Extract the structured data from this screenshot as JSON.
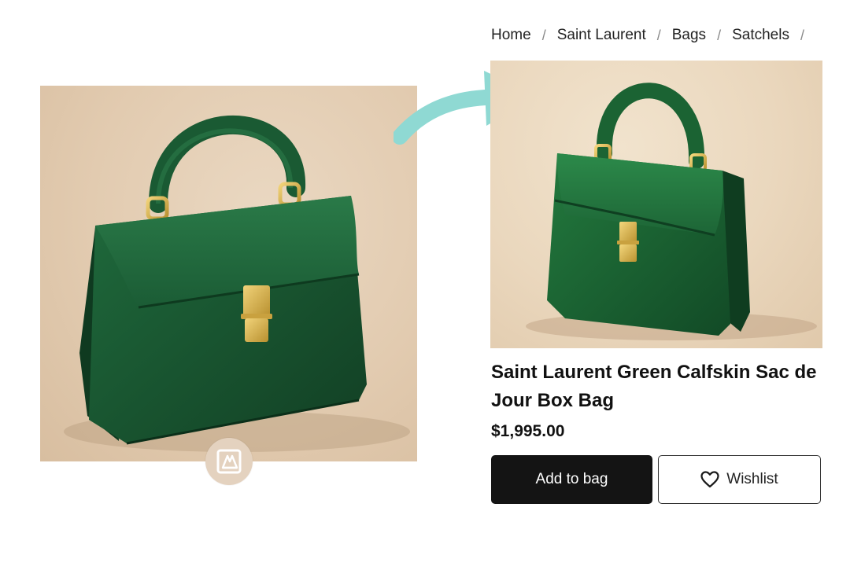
{
  "breadcrumb": {
    "items": [
      "Home",
      "Saint Laurent",
      "Bags",
      "Satchels"
    ],
    "separator": "/"
  },
  "product": {
    "title": "Saint Laurent Green Calfskin Sac de Jour Box Bag",
    "price": "$1,995.00"
  },
  "actions": {
    "add_to_bag_label": "Add to bag",
    "wishlist_label": "Wishlist"
  },
  "icons": {
    "lens": "visual-search-icon",
    "wishlist": "heart-icon",
    "arrow": "curved-arrow-icon"
  },
  "colors": {
    "leather_green": "#1d5a34",
    "hardware_gold": "#d7b04a",
    "photo_background": "#e6d3ba",
    "arrow": "#8fd9d3",
    "primary_button": "#141414"
  }
}
